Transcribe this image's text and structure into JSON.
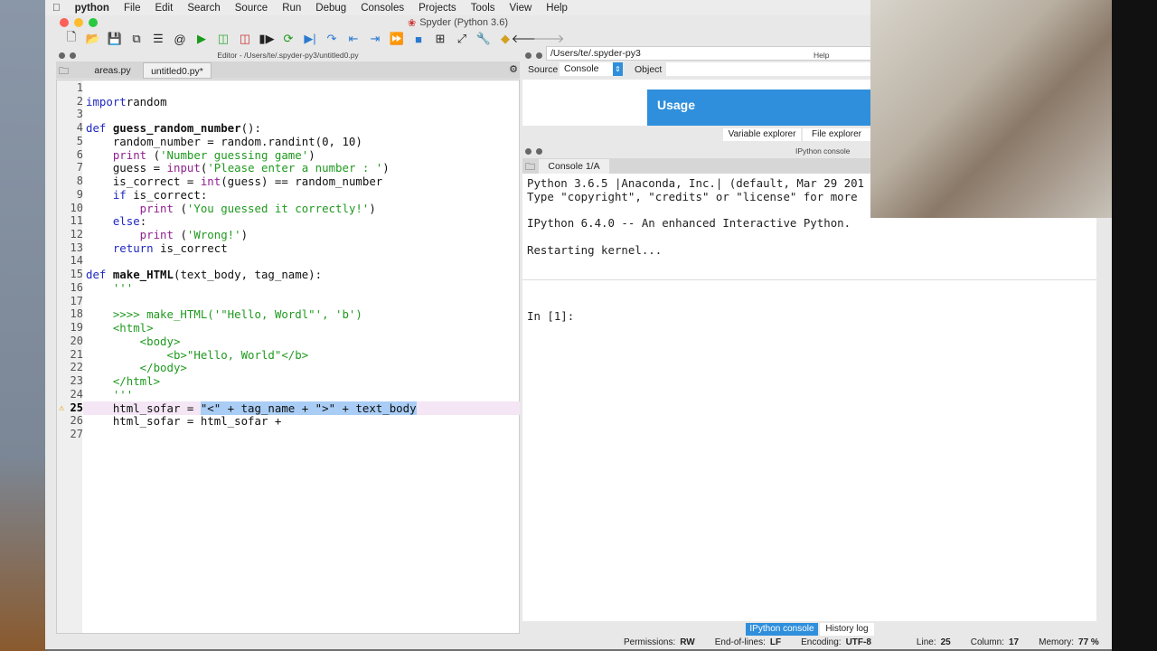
{
  "menubar": {
    "app": "python",
    "items": [
      "File",
      "Edit",
      "Search",
      "Source",
      "Run",
      "Debug",
      "Consoles",
      "Projects",
      "Tools",
      "View",
      "Help"
    ]
  },
  "window": {
    "title": "Spyder (Python 3.6)",
    "path": "/Users/te/.spyder-py3"
  },
  "editor": {
    "title": "Editor - /Users/te/.spyder-py3/untitled0.py",
    "tabs": [
      "areas.py",
      "untitled0.py*"
    ],
    "active_tab": 1,
    "current_line": 25,
    "lines": [
      [],
      [
        [
          "kw",
          "import"
        ],
        [
          "",
          "random"
        ]
      ],
      [],
      [
        [
          "kw",
          "def "
        ],
        [
          "fn",
          "guess_random_number"
        ],
        [
          "",
          "():"
        ]
      ],
      [
        [
          "",
          "    random_number = random.randint(0, 10)"
        ]
      ],
      [
        [
          "bi",
          "    print"
        ],
        [
          "",
          " ("
        ],
        [
          "st",
          "'Number guessing game'"
        ],
        [
          "",
          ")"
        ]
      ],
      [
        [
          "",
          "    guess = "
        ],
        [
          "bi",
          "input"
        ],
        [
          "",
          "("
        ],
        [
          "st",
          "'Please enter a number : '"
        ],
        [
          "",
          ")"
        ]
      ],
      [
        [
          "",
          "    is_correct = "
        ],
        [
          "bi",
          "int"
        ],
        [
          "",
          "(guess) == random_number"
        ]
      ],
      [
        [
          "kw",
          "    if"
        ],
        [
          "",
          " is_correct:"
        ]
      ],
      [
        [
          "bi",
          "        print"
        ],
        [
          "",
          " ("
        ],
        [
          "st",
          "'You guessed it correctly!'"
        ],
        [
          "",
          ")"
        ]
      ],
      [
        [
          "kw",
          "    else"
        ],
        [
          "",
          ":"
        ]
      ],
      [
        [
          "bi",
          "        print"
        ],
        [
          "",
          " ("
        ],
        [
          "st",
          "'Wrong!'"
        ],
        [
          "",
          ")"
        ]
      ],
      [
        [
          "kw",
          "    return"
        ],
        [
          "",
          " is_correct"
        ]
      ],
      [],
      [
        [
          "kw",
          "def "
        ],
        [
          "fn",
          "make_HTML"
        ],
        [
          "",
          "(text_body, tag_name):"
        ]
      ],
      [
        [
          "st",
          "    '''"
        ]
      ],
      [],
      [
        [
          "st",
          "    >>>> make_HTML('\"Hello, Wordl\"', 'b')"
        ]
      ],
      [
        [
          "st",
          "    <html>"
        ]
      ],
      [
        [
          "st",
          "        <body>"
        ]
      ],
      [
        [
          "st",
          "            <b>\"Hello, World\"</b>"
        ]
      ],
      [
        [
          "st",
          "        </body>"
        ]
      ],
      [
        [
          "st",
          "    </html>"
        ]
      ],
      [
        [
          "st",
          "    '''"
        ]
      ],
      [
        [
          "",
          "    html_sofar = "
        ],
        [
          "sel",
          "\"<\" + tag_name + \">\" + text_body"
        ]
      ],
      [
        [
          "",
          "    html_sofar = html_sofar +"
        ]
      ],
      []
    ]
  },
  "help": {
    "title": "Help",
    "source_label": "Source",
    "source_value": "Console",
    "object_label": "Object",
    "usage_title": "Usage",
    "tabs": [
      "Variable explorer",
      "File explorer"
    ]
  },
  "console": {
    "title": "IPython console",
    "tab": "Console 1/A",
    "lines": [
      "Python 3.6.5 |Anaconda, Inc.| (default, Mar 29 201",
      "Type \"copyright\", \"credits\" or \"license\" for more",
      "",
      "IPython 6.4.0 -- An enhanced Interactive Python.",
      "",
      "Restarting kernel...",
      "",
      "",
      "",
      "",
      "In [1]:"
    ],
    "bottom_tabs": [
      "IPython console",
      "History log"
    ]
  },
  "status": {
    "permissions_label": "Permissions:",
    "permissions": "RW",
    "eol_label": "End-of-lines:",
    "eol": "LF",
    "encoding_label": "Encoding:",
    "encoding": "UTF-8",
    "line_label": "Line:",
    "line": "25",
    "column_label": "Column:",
    "column": "17",
    "memory_label": "Memory:",
    "memory": "77 %"
  },
  "colors": {
    "accent": "#2f8fdc",
    "selection": "#a9cdf5",
    "keyword": "#1f28c0",
    "string": "#1f9a1f"
  }
}
